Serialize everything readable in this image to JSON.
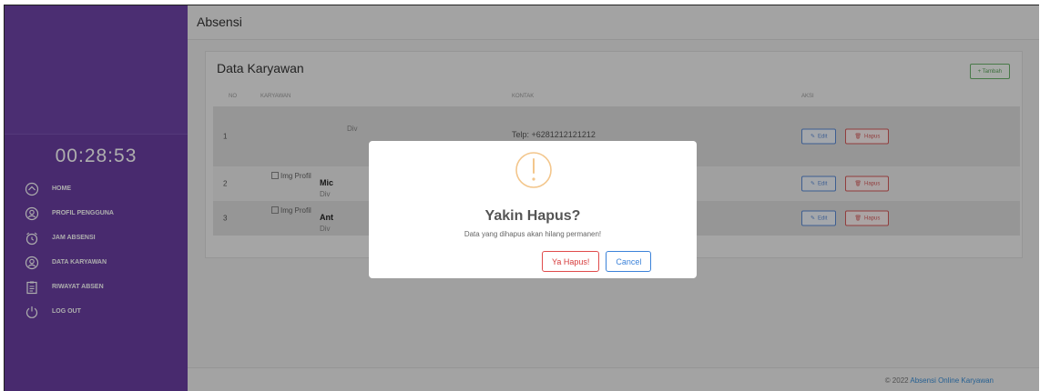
{
  "sidebar": {
    "clock": "00:28:53",
    "items": [
      {
        "label": "HOME",
        "icon": "home-icon"
      },
      {
        "label": "PROFIL PENGGUNA",
        "icon": "user-icon"
      },
      {
        "label": "JAM ABSENSI",
        "icon": "alarm-clock-icon"
      },
      {
        "label": "DATA KARYAWAN",
        "icon": "users-icon"
      },
      {
        "label": "RIWAYAT ABSEN",
        "icon": "clipboard-icon"
      },
      {
        "label": "LOG OUT",
        "icon": "power-icon"
      }
    ]
  },
  "header": {
    "title": "Absensi"
  },
  "card": {
    "title": "Data Karyawan",
    "add_button": "+ Tambah",
    "columns": [
      "NO",
      "KARYAWAN",
      "KONTAK",
      "AKSI"
    ],
    "rows": [
      {
        "no": "1",
        "image_alt": "",
        "name": "",
        "division": "Div",
        "contact": "Telp: +6281212121212"
      },
      {
        "no": "2",
        "image_alt": "Img Profil",
        "name": "Mic",
        "division": "Div",
        "contact": ""
      },
      {
        "no": "3",
        "image_alt": "Img Profil",
        "name": "Ant",
        "division": "Div",
        "contact": ""
      }
    ],
    "edit_label": "Edit",
    "delete_label": "Hapus"
  },
  "footer": {
    "copyright": "© 2022",
    "link_text": "Absensi Online Karyawan"
  },
  "modal": {
    "icon": "warning-icon",
    "title": "Yakin Hapus?",
    "text": "Data yang dihapus akan hilang permanen!",
    "confirm_label": "Ya Hapus!",
    "cancel_label": "Cancel"
  },
  "colors": {
    "sidebar": "#6a3fa3",
    "warning": "#f3c68c",
    "danger": "#d63a3a",
    "primary": "#3b82d9",
    "success": "#5aa35a"
  }
}
